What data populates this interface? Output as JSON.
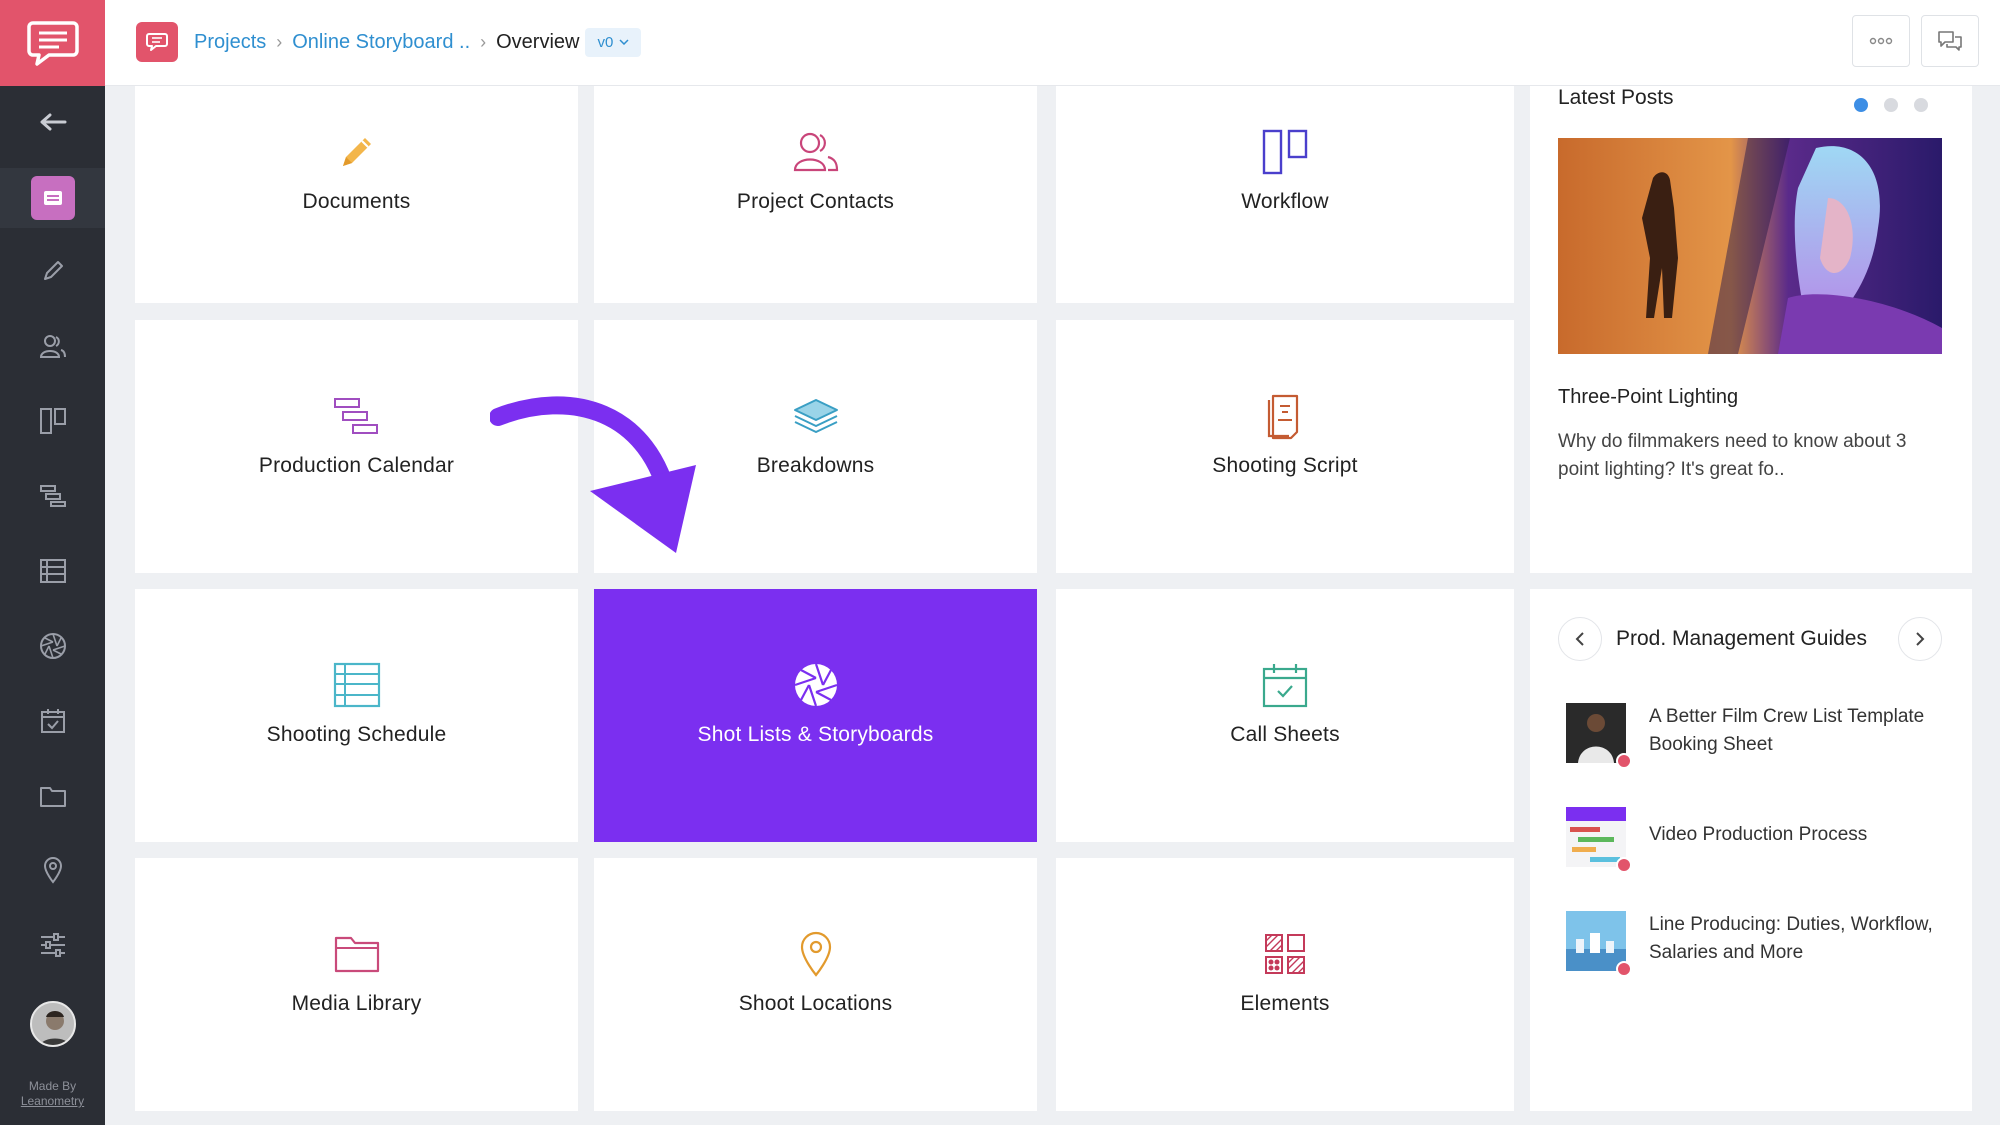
{
  "topbar": {
    "breadcrumb": [
      {
        "label": "Projects"
      },
      {
        "label": "Online Storyboard .."
      },
      {
        "label": "Overview"
      }
    ],
    "version": "v0"
  },
  "sidebar": {
    "made_by_line1": "Made By",
    "made_by_line2": "Leanometry",
    "items": [
      {
        "name": "back",
        "icon": "arrow-left-icon"
      },
      {
        "name": "overview",
        "icon": "overview-icon"
      },
      {
        "name": "documents",
        "icon": "pencil-icon"
      },
      {
        "name": "contacts",
        "icon": "contacts-icon"
      },
      {
        "name": "workflow",
        "icon": "workflow-icon"
      },
      {
        "name": "calendar",
        "icon": "calendar-bars-icon"
      },
      {
        "name": "schedule",
        "icon": "schedule-table-icon"
      },
      {
        "name": "shot-lists",
        "icon": "aperture-icon"
      },
      {
        "name": "call-sheets",
        "icon": "calendar-check-icon"
      },
      {
        "name": "media",
        "icon": "folder-icon"
      },
      {
        "name": "locations",
        "icon": "location-pin-icon"
      },
      {
        "name": "settings",
        "icon": "sliders-icon"
      }
    ]
  },
  "cards": [
    {
      "label": "Documents",
      "icon": "pencil-icon"
    },
    {
      "label": "Project Contacts",
      "icon": "contacts-icon"
    },
    {
      "label": "Workflow",
      "icon": "workflow-icon"
    },
    {
      "label": "Production Calendar",
      "icon": "calendar-bars-icon"
    },
    {
      "label": "Breakdowns",
      "icon": "layers-icon"
    },
    {
      "label": "Shooting Script",
      "icon": "script-icon"
    },
    {
      "label": "Shooting Schedule",
      "icon": "schedule-table-icon"
    },
    {
      "label": "Shot Lists & Storyboards",
      "icon": "aperture-icon",
      "highlighted": true
    },
    {
      "label": "Call Sheets",
      "icon": "calendar-check-icon"
    },
    {
      "label": "Media Library",
      "icon": "folder-icon"
    },
    {
      "label": "Shoot Locations",
      "icon": "location-pin-icon"
    },
    {
      "label": "Elements",
      "icon": "elements-grid-icon"
    }
  ],
  "latest_posts": {
    "title": "Latest Posts",
    "post_title": "Three-Point Lighting",
    "post_desc": "Why do filmmakers need to know about 3 point lighting? It's great fo.."
  },
  "guides": {
    "title": "Prod. Management Guides",
    "items": [
      {
        "label": "A Better Film Crew List Template Booking Sheet"
      },
      {
        "label": "Video Production Process"
      },
      {
        "label": "Line Producing: Duties, Workflow, Salaries and More"
      }
    ]
  },
  "colors": {
    "accent": "#7b2ff0",
    "brand": "#e2546b",
    "link": "#2f8fd0",
    "sidebar": "#2b2e35"
  }
}
